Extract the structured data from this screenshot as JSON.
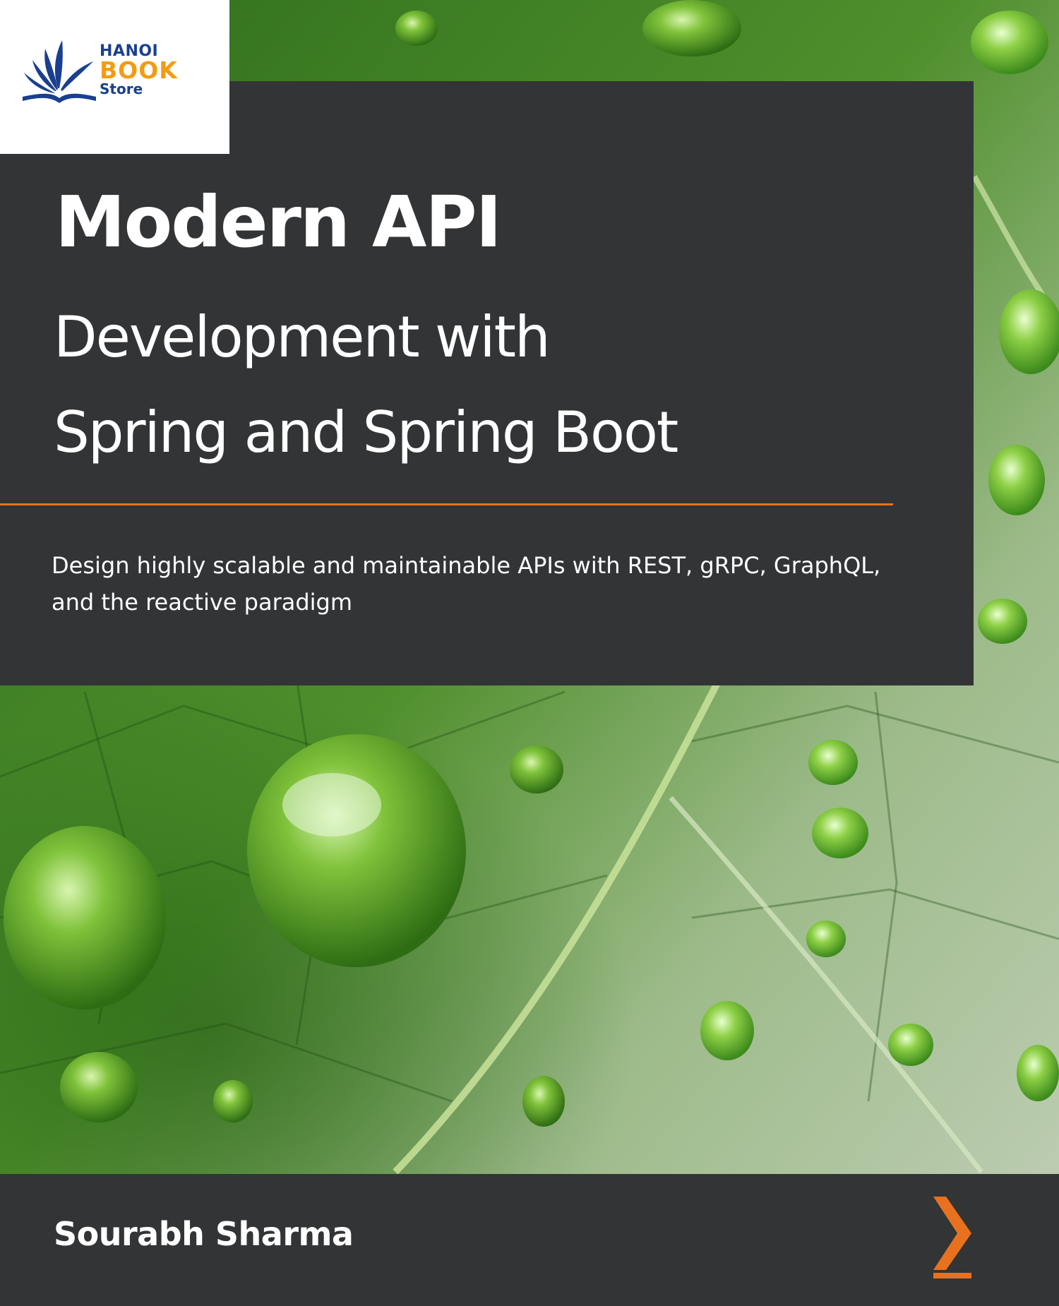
{
  "brand": {
    "line1": "HANOI",
    "line2": "BOOK",
    "line3": "Store"
  },
  "book": {
    "title_line1": "Modern API",
    "title_line2": "Development with",
    "title_line3": "Spring and Spring Boot",
    "subtitle": "Design highly scalable and maintainable APIs with REST, gRPC, GraphQL, and the reactive paradigm",
    "author": "Sourabh Sharma"
  },
  "colors": {
    "panel": "#323436",
    "accent": "#e8711f",
    "leaf": "#3e7a24",
    "brand_blue": "#1a3f8f",
    "brand_orange": "#f39c12"
  },
  "icons": {
    "publisher_mark": "chevron-right-icon",
    "logo_mark": "book-fan-icon"
  }
}
